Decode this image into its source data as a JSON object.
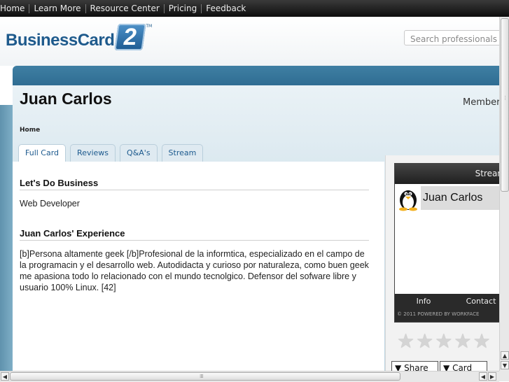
{
  "topnav": {
    "items": [
      "Home",
      "Learn More",
      "Resource Center",
      "Pricing",
      "Feedback"
    ]
  },
  "logo": {
    "text": "BusinessCard",
    "badge": "2",
    "tm": "TM"
  },
  "search": {
    "placeholder": "Search professionals"
  },
  "profile": {
    "name": "Juan Carlos",
    "member_label": "Member",
    "breadcrumb": "Home",
    "tabs": [
      "Full Card",
      "Reviews",
      "Q&A's",
      "Stream"
    ],
    "active_tab": "Full Card"
  },
  "sections": [
    {
      "title": "Let's Do Business",
      "text": "Web Developer"
    },
    {
      "title": "Juan Carlos' Experience",
      "text": "[b]Persona altamente geek [/b]Profesional de la informtica, especializado en el campo de la programacin y el desarrollo web. Autodidacta y curioso por naturaleza, como buen geek me apasiona todo lo relacionado con el mundo tecnolgico. Defensor del sofware libre y usuario 100% Linux. [42]"
    }
  ],
  "widget": {
    "header": "Stream",
    "user_name": "Juan Carlos",
    "links": [
      "Info",
      "Contact"
    ],
    "copyright": "© 2011 POWERED BY WORKFACE",
    "avatar_icon": "tux-penguin-icon"
  },
  "rating": {
    "stars_total": 5,
    "stars_filled": 0
  },
  "actions": {
    "share_label": "Share",
    "card_label": "Card"
  },
  "colors": {
    "brand_blue": "#1e5a8c",
    "banner": "#3f7fa3",
    "tab_text": "#1d5a8e"
  }
}
